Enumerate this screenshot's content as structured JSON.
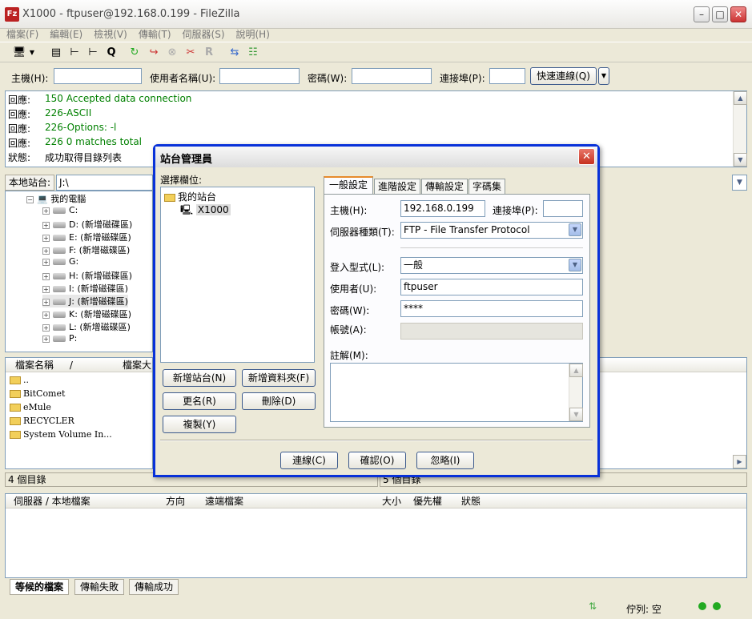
{
  "window": {
    "title": "X1000 - ftpuser@192.168.0.199 - FileZilla",
    "icon": "Fz"
  },
  "menu": [
    "檔案(F)",
    "編輯(E)",
    "檢視(V)",
    "傳輸(T)",
    "伺服器(S)",
    "說明(H)"
  ],
  "quickconnect": {
    "host_label": "主機(H):",
    "user_label": "使用者名稱(U):",
    "pass_label": "密碼(W):",
    "port_label": "連接埠(P):",
    "button": "快速連線(Q)"
  },
  "log": [
    {
      "key": "回應:",
      "value": "150 Accepted data connection",
      "color": "#008000"
    },
    {
      "key": "回應:",
      "value": "226-ASCII",
      "color": "#008000"
    },
    {
      "key": "回應:",
      "value": "226-Options: -l",
      "color": "#008000"
    },
    {
      "key": "回應:",
      "value": "226 0 matches total",
      "color": "#008000"
    },
    {
      "key": "狀態:",
      "value": "成功取得目錄列表",
      "color": "#000000"
    }
  ],
  "local": {
    "label": "本地站台:",
    "path": "J:\\",
    "tree_root": "我的電腦",
    "drives": [
      "C:",
      "D: (新增磁碟區)",
      "E: (新增磁碟區)",
      "F: (新增磁碟區)",
      "G:",
      "H: (新增磁碟區)",
      "I: (新增磁碟區)",
      "J: (新增磁碟區)",
      "K: (新增磁碟區)",
      "L: (新增磁碟區)",
      "P:"
    ],
    "col_name": "檔案名稱",
    "col_sort": "/",
    "col_size": "檔案大",
    "files": [
      "..",
      "BitComet",
      "eMule",
      "RECYCLER",
      "System Volume In..."
    ],
    "status": "4 個目錄"
  },
  "remote": {
    "status": "5 個目錄"
  },
  "queue": {
    "headers": [
      "伺服器 / 本地檔案",
      "方向",
      "遠端檔案",
      "大小",
      "優先權",
      "狀態"
    ],
    "tabs": [
      "等候的檔案",
      "傳輸失敗",
      "傳輸成功"
    ]
  },
  "statusbar": {
    "queue": "佇列: 空"
  },
  "dialog": {
    "title": "站台管理員",
    "select_label": "選擇欄位:",
    "tree_root": "我的站台",
    "tree_site": "X1000",
    "buttons": {
      "new_site": "新增站台(N)",
      "new_folder": "新增資料夾(F)",
      "rename": "更名(R)",
      "delete": "刪除(D)",
      "copy": "複製(Y)"
    },
    "tabs": [
      "一般設定",
      "進階設定",
      "傳輸設定",
      "字碼集"
    ],
    "host_label": "主機(H):",
    "host_value": "192.168.0.199",
    "port_label": "連接埠(P):",
    "port_value": "",
    "server_type_label": "伺服器種類(T):",
    "server_type_value": "FTP - File Transfer Protocol",
    "logon_label": "登入型式(L):",
    "logon_value": "一般",
    "user_label": "使用者(U):",
    "user_value": "ftpuser",
    "pass_label": "密碼(W):",
    "pass_value": "****",
    "account_label": "帳號(A):",
    "comments_label": "註解(M):",
    "footer": {
      "connect": "連線(C)",
      "ok": "確認(O)",
      "cancel": "忽略(I)"
    }
  }
}
